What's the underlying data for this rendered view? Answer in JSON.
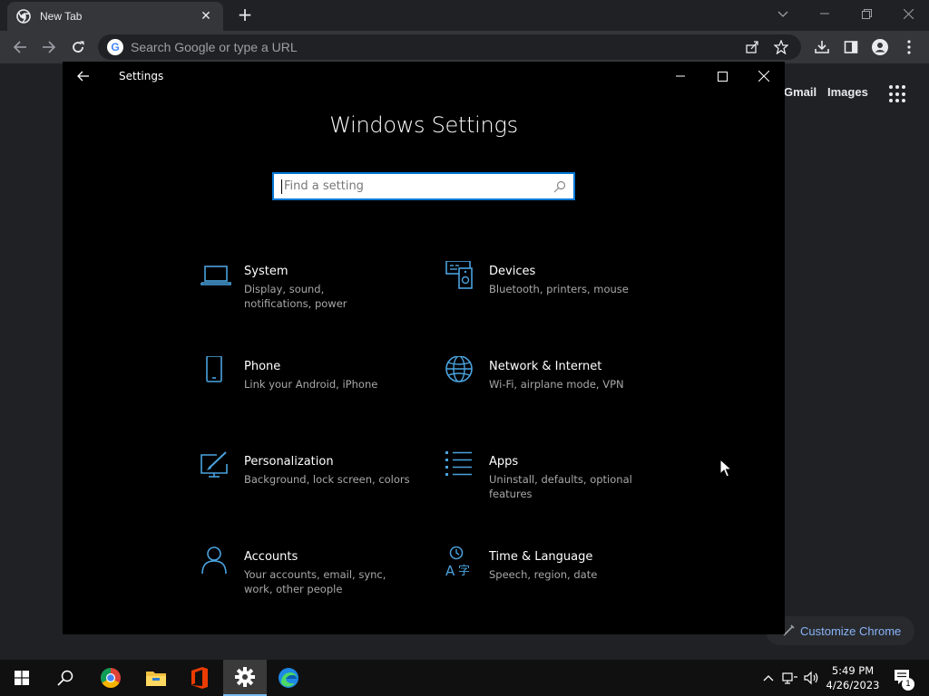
{
  "chrome": {
    "tab_title": "New Tab",
    "omnibox_placeholder": "Search Google or type a URL",
    "ntp_links": [
      "Gmail",
      "Images"
    ],
    "customize_label": "Customize Chrome"
  },
  "settings": {
    "window_title": "Settings",
    "heading": "Windows Settings",
    "search_placeholder": "Find a setting",
    "accent_color": "#0078d7",
    "categories": [
      {
        "name": "System",
        "desc": "Display, sound, notifications, power",
        "icon": "laptop-icon"
      },
      {
        "name": "Devices",
        "desc": "Bluetooth, printers, mouse",
        "icon": "devices-icon"
      },
      {
        "name": "Phone",
        "desc": "Link your Android, iPhone",
        "icon": "phone-icon"
      },
      {
        "name": "Network & Internet",
        "desc": "Wi-Fi, airplane mode, VPN",
        "icon": "globe-icon"
      },
      {
        "name": "Personalization",
        "desc": "Background, lock screen, colors",
        "icon": "personalization-icon"
      },
      {
        "name": "Apps",
        "desc": "Uninstall, defaults, optional features",
        "icon": "apps-list-icon"
      },
      {
        "name": "Accounts",
        "desc": "Your accounts, email, sync, work, other people",
        "icon": "person-icon"
      },
      {
        "name": "Time & Language",
        "desc": "Speech, region, date",
        "icon": "time-language-icon"
      }
    ]
  },
  "taskbar": {
    "time": "5:49 PM",
    "date": "4/26/2023",
    "notification_count": "1"
  }
}
